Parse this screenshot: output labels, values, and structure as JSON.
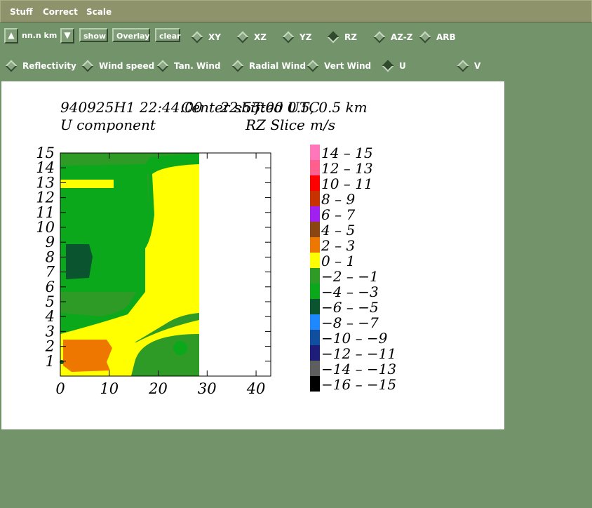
{
  "menu": {
    "items": [
      "Stuff",
      "Correct",
      "Scale"
    ]
  },
  "controls": {
    "up_arrow": "▲",
    "down_arrow": "▼",
    "step_label": "nn.n km",
    "show_label": "show",
    "overlay_label": "Overlay",
    "clear_label": "clear",
    "planes": [
      {
        "label": "XY",
        "selected": false
      },
      {
        "label": "XZ",
        "selected": false
      },
      {
        "label": "YZ",
        "selected": false
      },
      {
        "label": "RZ",
        "selected": true
      },
      {
        "label": "AZ-Z",
        "selected": false
      },
      {
        "label": "ARB",
        "selected": false
      }
    ],
    "fields": [
      {
        "label": "Reflectivity",
        "selected": false
      },
      {
        "label": "Wind speed",
        "selected": false
      },
      {
        "label": "Tan. Wind",
        "selected": false
      },
      {
        "label": "Radial Wind",
        "selected": false
      },
      {
        "label": "Vert Wind",
        "selected": false
      },
      {
        "label": "U",
        "selected": true
      },
      {
        "label": "V",
        "selected": false
      }
    ]
  },
  "plot": {
    "header_line1": "940925H1  22:44:00",
    "header_overlap": "Center shifted  0.5, 0.5 km",
    "header_time": "22:55:00 UTC",
    "header_line2_left": "U component",
    "header_line2_right": "RZ Slice",
    "units": "m/s"
  },
  "chart_data": {
    "type": "heatmap",
    "x_ticks": [
      0,
      10,
      20,
      30,
      40
    ],
    "y_ticks": [
      1,
      2,
      3,
      4,
      5,
      6,
      7,
      8,
      9,
      10,
      11,
      12,
      13,
      14,
      15
    ],
    "xlim": [
      0,
      43
    ],
    "ylim": [
      0,
      15
    ],
    "legend": [
      {
        "label": "14 – 15",
        "color": "#ff77bb"
      },
      {
        "label": "12 – 13",
        "color": "#ff5f8f"
      },
      {
        "label": "10 – 11",
        "color": "#ff0000"
      },
      {
        "label": "8 – 9",
        "color": "#c83200"
      },
      {
        "label": "6 – 7",
        "color": "#a020f0"
      },
      {
        "label": "4 – 5",
        "color": "#8b4513"
      },
      {
        "label": "2 – 3",
        "color": "#ee7700"
      },
      {
        "label": "0 – 1",
        "color": "#ffff00"
      },
      {
        "label": "−2 – −1",
        "color": "#2e9b27"
      },
      {
        "label": "−4 – −3",
        "color": "#0aa81a"
      },
      {
        "label": "−6 – −5",
        "color": "#0a5530"
      },
      {
        "label": "−8 – −7",
        "color": "#1e88ff"
      },
      {
        "label": "−10 – −9",
        "color": "#104ea0"
      },
      {
        "label": "−12 – −11",
        "color": "#1e1e7a"
      },
      {
        "label": "−14 – −13",
        "color": "#5e5e5e"
      },
      {
        "label": "−16 – −15",
        "color": "#000000"
      }
    ]
  }
}
